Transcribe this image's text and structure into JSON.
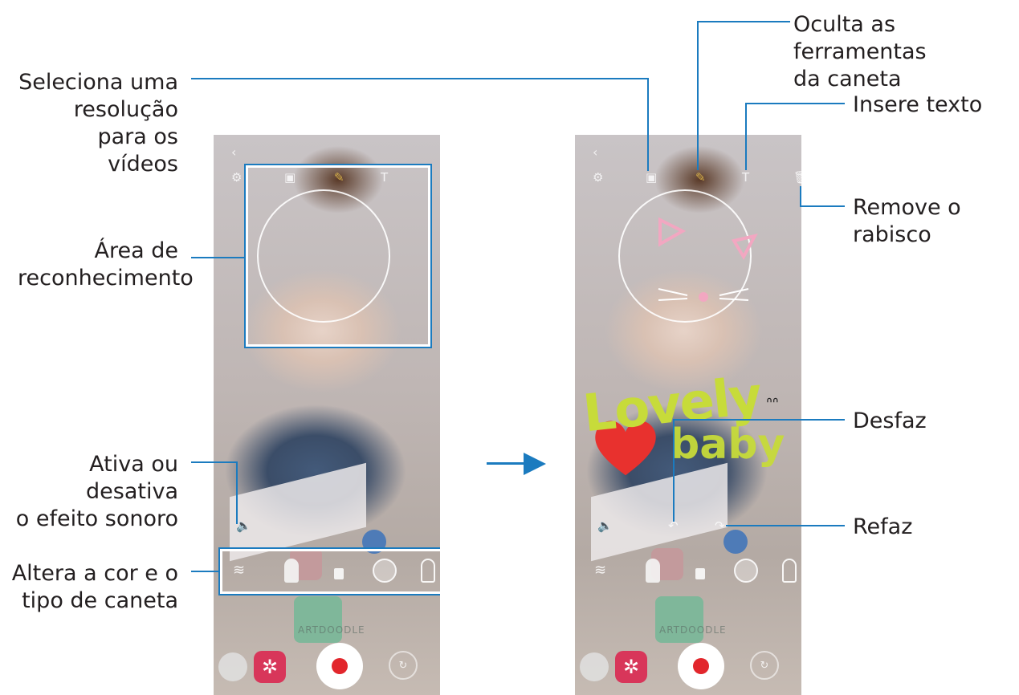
{
  "labels": {
    "resolution": "Seleciona uma\nresolução para os\nvídeos",
    "recognition": "Área de\nreconhecimento",
    "sound": "Ativa ou desativa\no efeito sonoro",
    "pen_type": "Altera a cor e o\ntipo de caneta",
    "hide_tools": "Oculta as ferramentas\nda caneta",
    "insert_text": "Insere texto",
    "remove_doodle": "Remove o\nrabisco",
    "undo": "Desfaz",
    "redo": "Refaz"
  },
  "left_phone": {
    "brand_text": "ARTDOODLE"
  },
  "right_phone": {
    "brand_text": "ARTDOODLE",
    "doodle_line1": "Lovely",
    "doodle_line2": "baby"
  },
  "icons": {
    "settings": "gear-icon",
    "resolution": "resolution-icon",
    "pen": "pen-icon",
    "text": "text-icon",
    "delete": "trash-icon",
    "undo": "undo-icon",
    "redo": "redo-icon",
    "sound": "speaker-icon",
    "effects": "effects-icon",
    "record": "record-icon",
    "switch": "switch-camera-icon"
  },
  "colors": {
    "accent": "#1b7bbf",
    "record": "#e2262c",
    "effects": "#d8365a",
    "doodle": "#c7db3a",
    "heart": "#e8312e"
  }
}
